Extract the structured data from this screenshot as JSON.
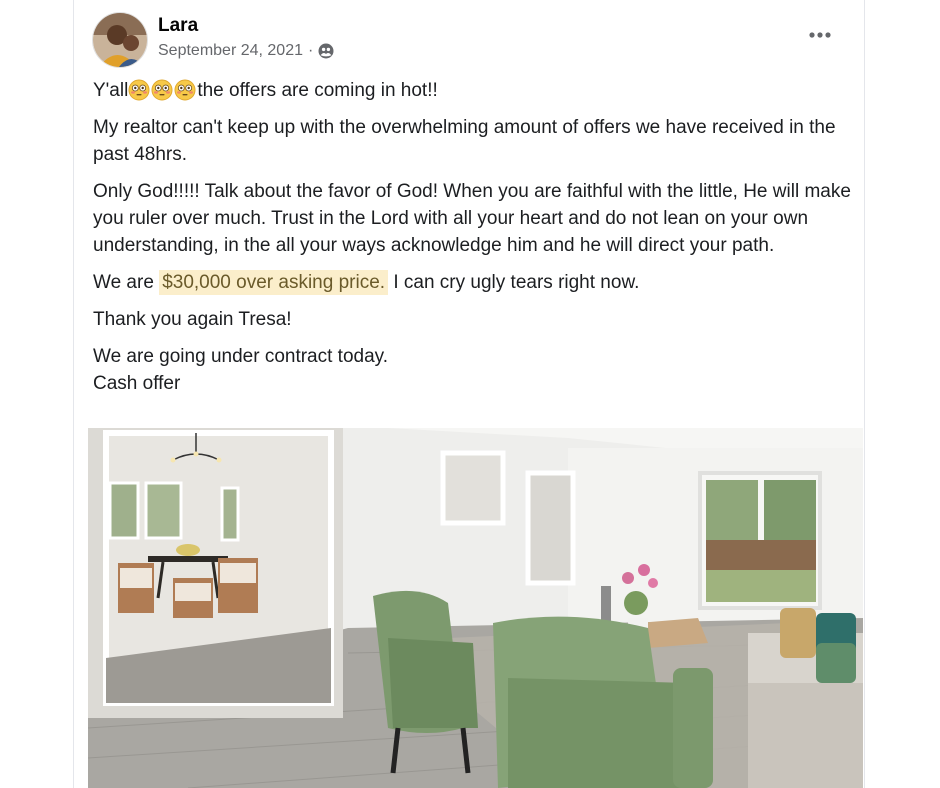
{
  "post": {
    "author": "Lara",
    "date": "September 24, 2021",
    "separator": "·",
    "privacy_icon": "friends-icon",
    "more_icon": "more-options-icon",
    "line1_prefix": "Y'all",
    "line1_emoji": "flushed-face-emoji",
    "line1_suffix": "the offers are coming in hot!!",
    "para2": "My realtor can't keep up with the overwhelming amount of offers we have received in the past 48hrs.",
    "para3": "Only God!!!!! Talk about the favor of God! When you are faithful with the little, He will make you ruler over much. Trust in the Lord with all your heart and do not lean on your own understanding, in the all your ways acknowledge him and he will direct your path.",
    "para4_prefix": "We are ",
    "para4_highlight": "$30,000 over asking price.",
    "para4_suffix": " I can cry ugly tears right now.",
    "para5": "Thank you again Tresa!",
    "para6_line1": "We are going under contract today.",
    "para6_line2": "Cash offer"
  },
  "colors": {
    "text": "#1c1e21",
    "meta": "#65676b",
    "highlight_bg": "#fbeecb",
    "highlight_text": "#6a5a2a"
  },
  "photo": {
    "subject": "living-room-photo"
  }
}
